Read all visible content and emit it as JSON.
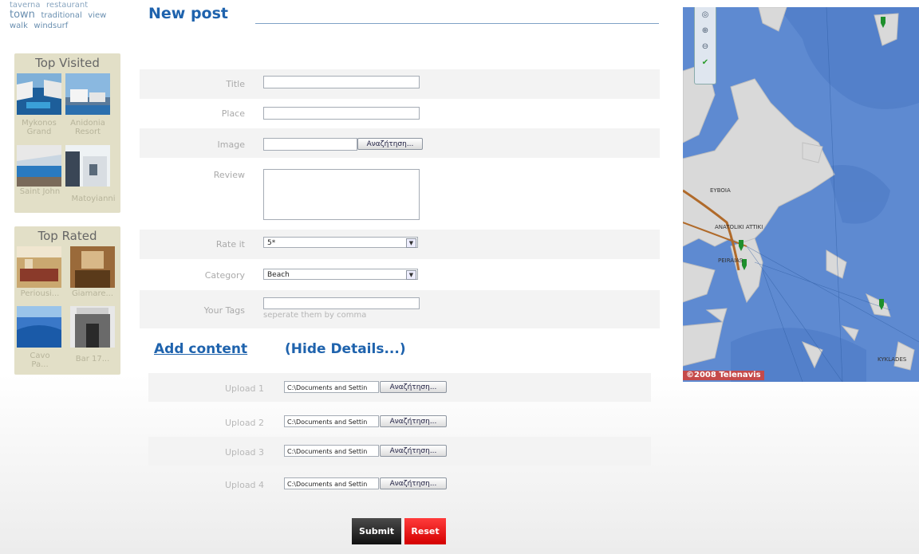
{
  "tags": {
    "cut": [
      "taverna",
      "restaurant"
    ],
    "row": [
      "town",
      "traditional",
      "view"
    ],
    "row2": [
      "walk",
      "windsurf"
    ]
  },
  "top_visited": {
    "title": "Top Visited",
    "items": [
      "Mykonos Grand",
      "Anidonia Resort",
      "Saint John",
      "Matoyianni"
    ]
  },
  "top_rated": {
    "title": "Top Rated",
    "items": [
      "Periousi...",
      "Giamare...",
      "Cavo Pa...",
      "Bar 17..."
    ]
  },
  "form": {
    "title": "New post",
    "labels": {
      "title": "Title",
      "place": "Place",
      "image": "Image",
      "review": "Review",
      "rate": "Rate it",
      "category": "Category",
      "tags": "Your Tags"
    },
    "browse_label": "Αναζήτηση...",
    "rate_value": "5*",
    "category_value": "Beach",
    "tags_hint": "seperate them by comma"
  },
  "content": {
    "add_label": "Add content",
    "hide_label": "(Hide Details...)",
    "uploads": [
      {
        "label": "Upload 1",
        "path": "C:\\Documents and Settin"
      },
      {
        "label": "Upload 2",
        "path": "C:\\Documents and Settin"
      },
      {
        "label": "Upload 3",
        "path": "C:\\Documents and Settin"
      },
      {
        "label": "Upload 4",
        "path": "C:\\Documents and Settin"
      }
    ]
  },
  "actions": {
    "submit": "Submit",
    "reset": "Reset"
  },
  "map": {
    "copyright": "©2008 Telenavis",
    "labels": [
      "EYBOIA",
      "ANATOLIKI ATTIKI",
      "PEIRAIAS",
      "KYKLADES"
    ]
  },
  "colors": {
    "title_blue": "#1f63ad",
    "sidebar_bg": "#e2dfc7",
    "sea": "#5e8ad1",
    "land": "#d8d8d8",
    "reset_red": "#e00000"
  }
}
